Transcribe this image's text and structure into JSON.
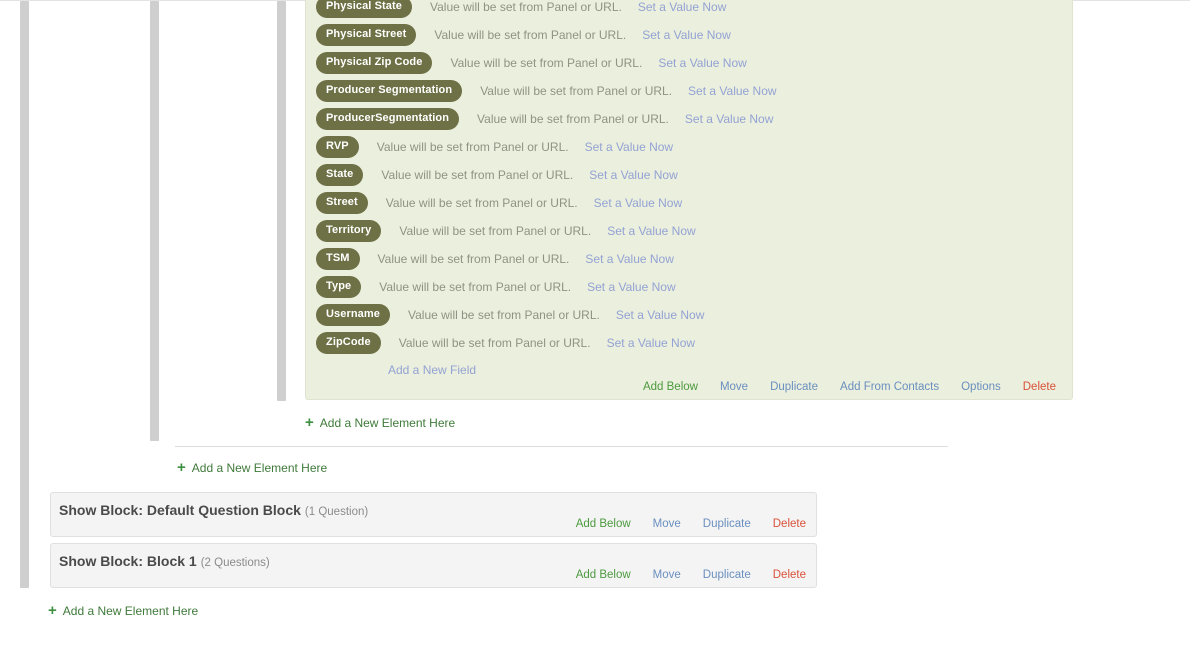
{
  "embedded_data_panel": {
    "note_text": "Value will be set from Panel or URL.",
    "set_value_label": "Set a Value Now",
    "add_field_label": "Add a New Field",
    "fields": [
      {
        "name": "Physical State"
      },
      {
        "name": "Physical Street"
      },
      {
        "name": "Physical Zip Code"
      },
      {
        "name": "Producer Segmentation"
      },
      {
        "name": "ProducerSegmentation"
      },
      {
        "name": "RVP"
      },
      {
        "name": "State"
      },
      {
        "name": "Street"
      },
      {
        "name": "Territory"
      },
      {
        "name": "TSM"
      },
      {
        "name": "Type"
      },
      {
        "name": "Username"
      },
      {
        "name": "ZipCode"
      }
    ],
    "footer_actions": [
      {
        "label": "Add Below",
        "style": "green"
      },
      {
        "label": "Move",
        "style": "blue"
      },
      {
        "label": "Duplicate",
        "style": "blue"
      },
      {
        "label": "Add From Contacts",
        "style": "blue"
      },
      {
        "label": "Options",
        "style": "blue"
      },
      {
        "label": "Delete",
        "style": "red"
      }
    ]
  },
  "add_element_links": [
    {
      "plus": "+",
      "label": "Add a New Element Here"
    },
    {
      "plus": "+",
      "label": "Add a New Element Here"
    },
    {
      "plus": "+",
      "label": "Add a New Element Here"
    }
  ],
  "show_blocks": [
    {
      "title": "Show Block: Default Question Block",
      "count": "(1 Question)",
      "actions": [
        {
          "label": "Add Below",
          "style": "green"
        },
        {
          "label": "Move",
          "style": "blue"
        },
        {
          "label": "Duplicate",
          "style": "blue"
        },
        {
          "label": "Delete",
          "style": "red"
        }
      ]
    },
    {
      "title": "Show Block: Block 1",
      "count": "(2 Questions)",
      "actions": [
        {
          "label": "Add Below",
          "style": "green"
        },
        {
          "label": "Move",
          "style": "blue"
        },
        {
          "label": "Duplicate",
          "style": "blue"
        },
        {
          "label": "Delete",
          "style": "red"
        }
      ]
    }
  ],
  "colors": {
    "panel_background": "#ebefdd",
    "pill_background": "#6e7045",
    "link_blue": "#93a2d4",
    "action_green": "#4c9a3f",
    "action_blue": "#6a8fbf",
    "action_red": "#d9513a",
    "note_text": "#8e9483",
    "rail_grey": "#cfcfcf",
    "block_background": "#f4f4f4"
  }
}
